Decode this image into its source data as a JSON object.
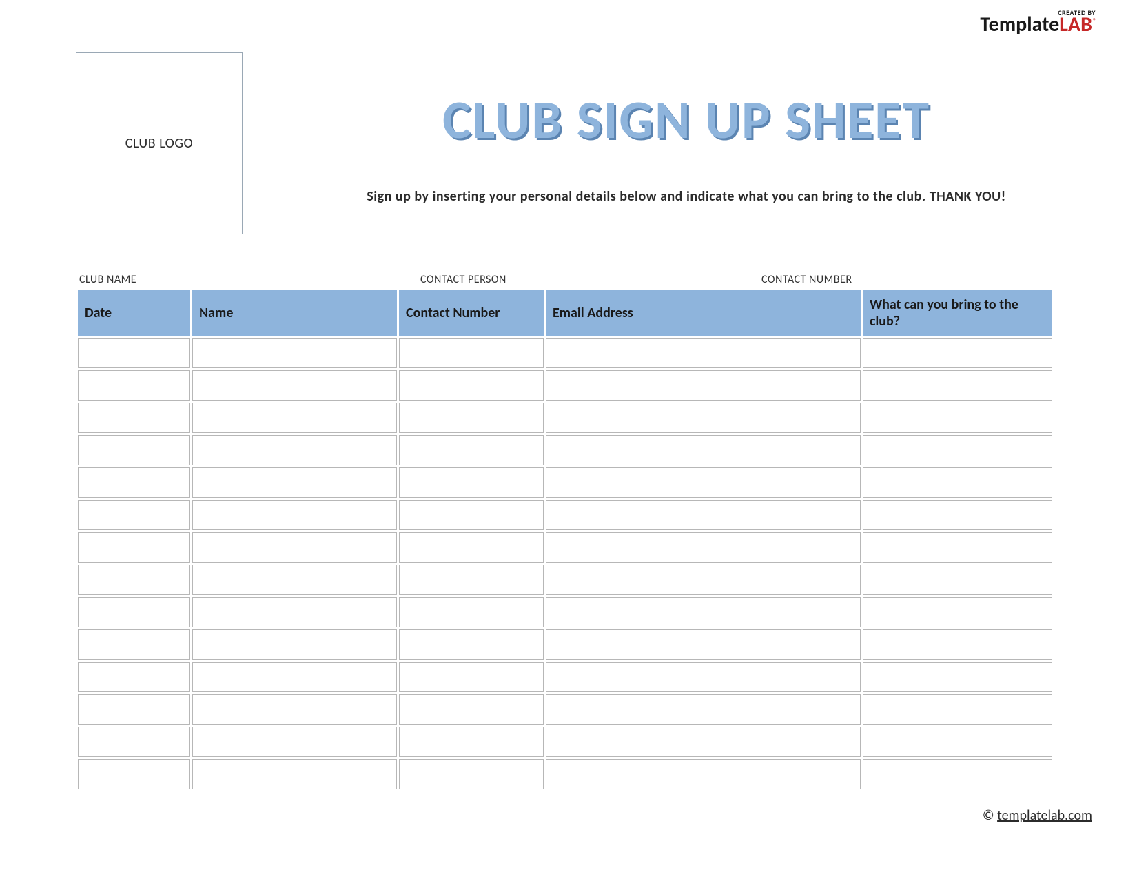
{
  "brand": {
    "created_by": "CREATED BY",
    "name_a": "Template",
    "name_b": "LAB",
    "reg": "®"
  },
  "logo_placeholder": "CLUB LOGO",
  "title": "CLUB SIGN UP SHEET",
  "subtitle": "Sign up by inserting your personal details below and indicate what you can bring to the club. THANK YOU!",
  "fields": {
    "blank_line": "________________________________________________",
    "club_name": "CLUB NAME",
    "contact_person": "CONTACT PERSON",
    "contact_number": "CONTACT NUMBER"
  },
  "columns": {
    "date": "Date",
    "name": "Name",
    "contact_number": "Contact Number",
    "email": "Email Address",
    "bring": "What can you bring to the club?"
  },
  "row_count": 14,
  "footer": {
    "copyright": "©",
    "link_text": "templatelab.com"
  }
}
